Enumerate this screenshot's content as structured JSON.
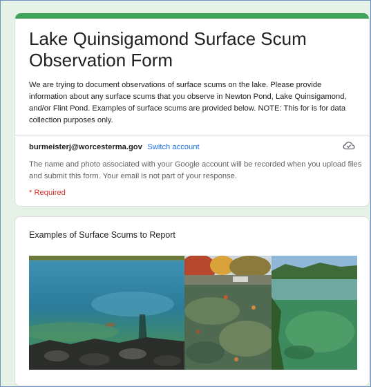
{
  "form": {
    "title": "Lake Quinsigamond Surface Scum Observation Form",
    "description": "We are trying to document observations of surface scums on the lake. Please provide information about any surface scums that you observe in Newton Pond, Lake Quinsigamond, and/or Flint Pond. Examples of surface scums are provided below. NOTE: This for is for data collection purposes only.",
    "account_email": "burmeisterj@worcesterma.gov",
    "switch_account_label": "Switch account",
    "account_notice": "The name and photo associated with your Google account will be recorded when you upload files and submit this form. Your email is not part of your response.",
    "required_note": "* Required",
    "cloud_icon": "cloud-saved-icon"
  },
  "examples_section": {
    "title": "Examples of Surface Scums to Report",
    "photos": [
      {
        "name": "lake-photo-blue-green-water"
      },
      {
        "name": "lake-photo-foliage-scum"
      },
      {
        "name": "lake-photo-green-shoreline"
      }
    ]
  },
  "colors": {
    "accent_bar": "#3fa45a",
    "link": "#1a73e8",
    "required": "#d93025",
    "page_background": "#e6f2e8"
  }
}
